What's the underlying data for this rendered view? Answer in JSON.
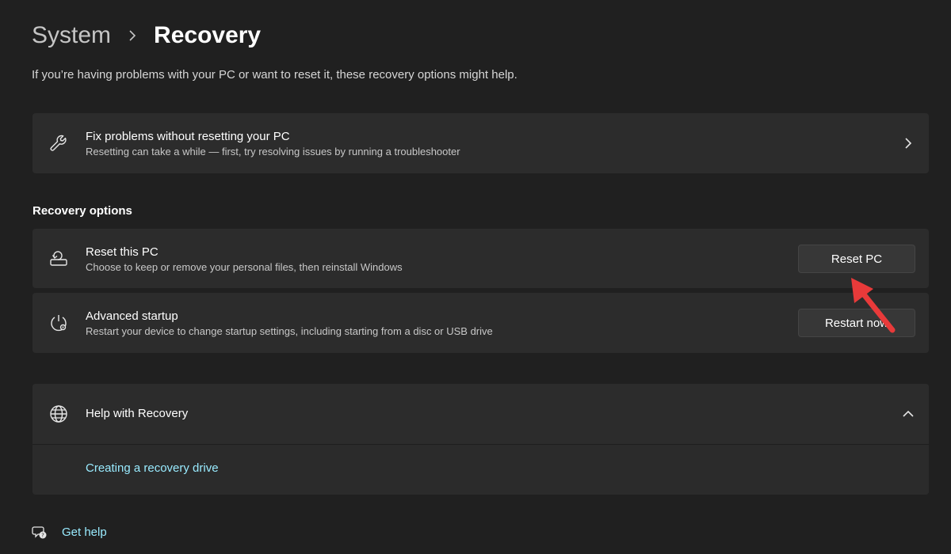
{
  "breadcrumb": {
    "parent": "System",
    "current": "Recovery"
  },
  "description": "If you’re having problems with your PC or want to reset it, these recovery options might help.",
  "fix_problems": {
    "title": "Fix problems without resetting your PC",
    "subtitle": "Resetting can take a while — first, try resolving issues by running a troubleshooter",
    "icon": "wrench-icon"
  },
  "recovery_options": {
    "heading": "Recovery options",
    "items": [
      {
        "title": "Reset this PC",
        "subtitle": "Choose to keep or remove your personal files, then reinstall Windows",
        "button": "Reset PC",
        "icon": "reset-pc-icon"
      },
      {
        "title": "Advanced startup",
        "subtitle": "Restart your device to change startup settings, including starting from a disc or USB drive",
        "button": "Restart now",
        "icon": "advanced-startup-icon"
      }
    ]
  },
  "help": {
    "title": "Help with Recovery",
    "link": "Creating a recovery drive",
    "icon": "globe-icon",
    "expanded": true
  },
  "get_help": {
    "label": "Get help",
    "icon": "get-help-icon"
  },
  "colors": {
    "background": "#202020",
    "card": "#2c2c2c",
    "link": "#99ebff",
    "annotation": "#e83a3a"
  }
}
